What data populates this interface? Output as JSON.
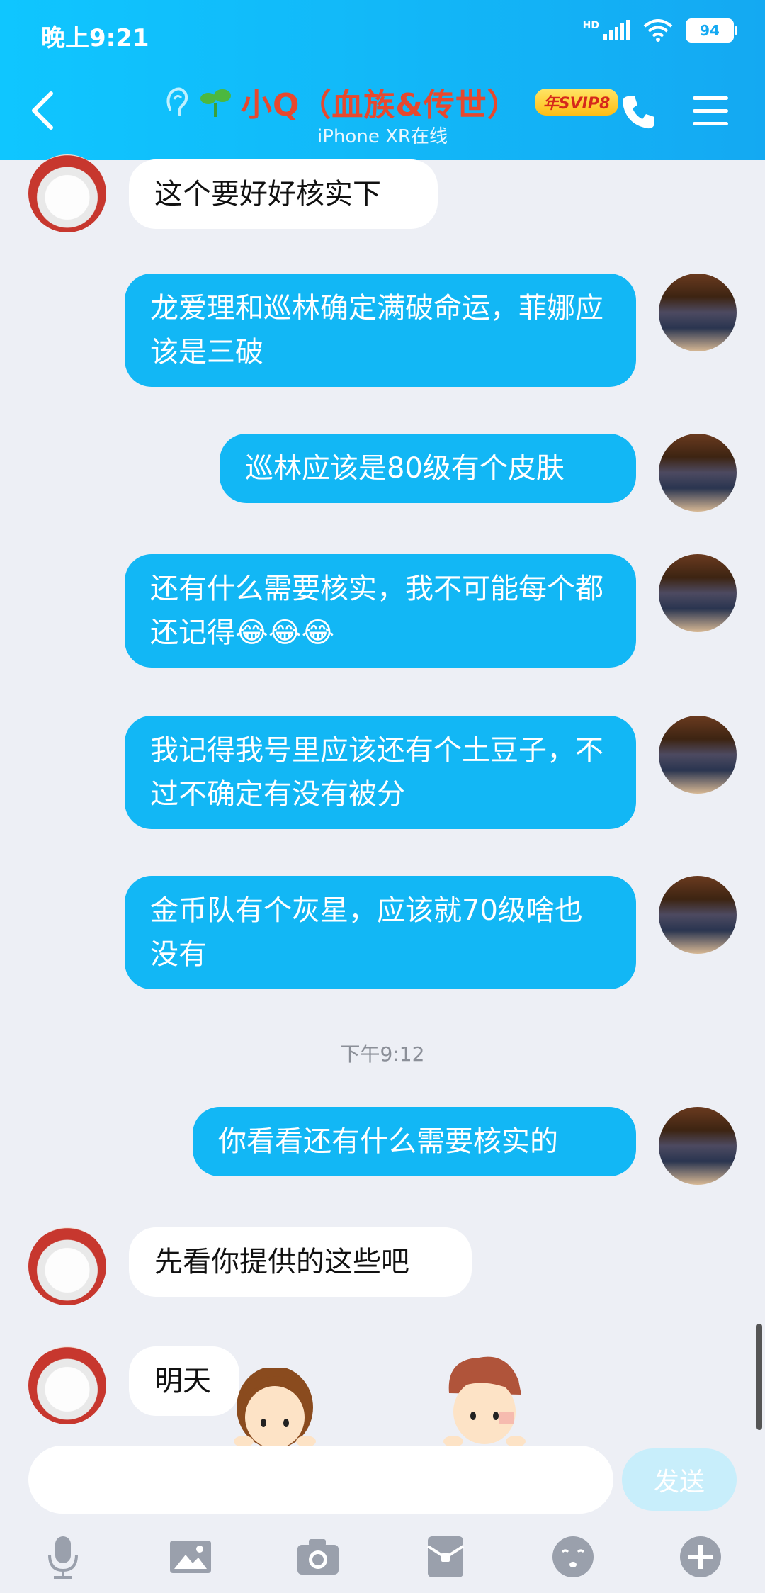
{
  "status_bar": {
    "time": "晚上9:21",
    "battery": "94",
    "hd": "HD"
  },
  "header": {
    "title": "小Q（血族&传世）",
    "badge": "年SVIP8",
    "subtitle": "iPhone XR在线"
  },
  "messages": [
    {
      "side": "left",
      "text": "这个要好好核实下"
    },
    {
      "side": "right",
      "text": "龙爱理和巡林确定满破命运，菲娜应该是三破"
    },
    {
      "side": "right",
      "text": "巡林应该是80级有个皮肤"
    },
    {
      "side": "right",
      "text": "还有什么需要核实，我不可能每个都还记得😂😂😂"
    },
    {
      "side": "right",
      "text": "我记得我号里应该还有个土豆子，不过不确定有没有被分"
    },
    {
      "side": "right",
      "text": "金币队有个灰星，应该就70级啥也没有"
    },
    {
      "side": "right",
      "text": "你看看还有什么需要核实的"
    },
    {
      "side": "left",
      "text": "先看你提供的这些吧"
    },
    {
      "side": "left",
      "text": "明天"
    }
  ],
  "timestamp": "下午9:12",
  "input": {
    "send_label": "发送",
    "value": ""
  },
  "toolbar": [
    "microphone-icon",
    "image-icon",
    "camera-icon",
    "red-packet-icon",
    "emoji-icon",
    "plus-icon"
  ],
  "colors": {
    "header": "#12b8f8",
    "bubble_self": "#12b7f5",
    "background": "#edeff5",
    "title": "#e8482d"
  }
}
